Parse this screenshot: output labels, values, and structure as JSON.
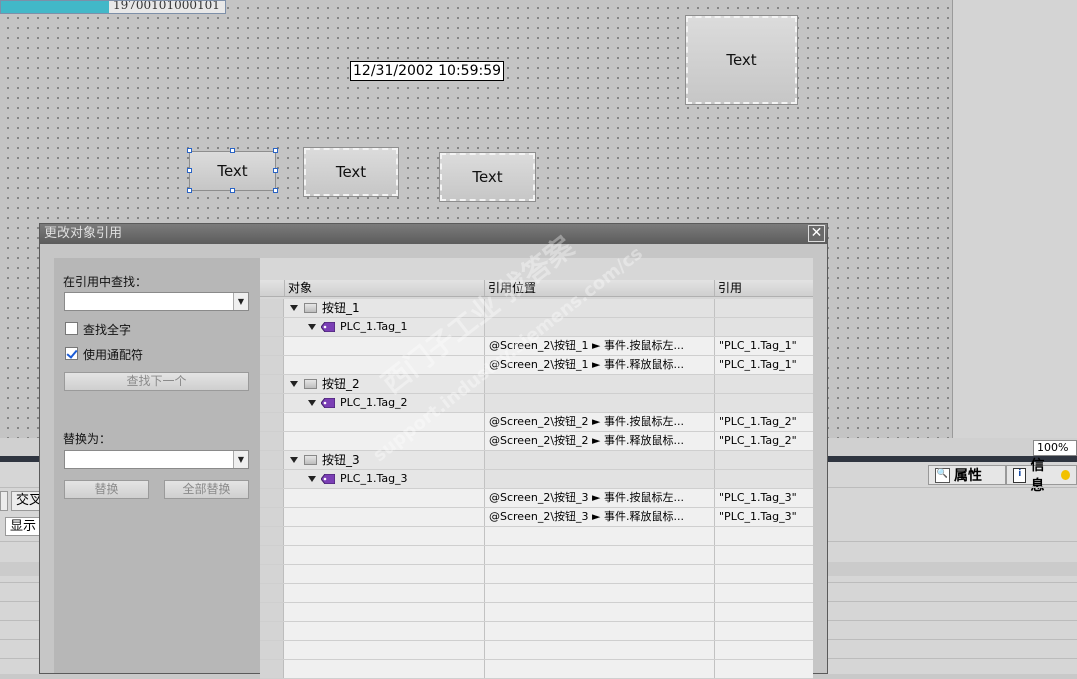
{
  "canvas": {
    "io_field_value": "19700101000101",
    "datetime": "12/31/2002 10:59:59",
    "buttons": {
      "b1": "Text",
      "b2": "Text",
      "b3": "Text",
      "b4": "Text"
    }
  },
  "zoom": "100%",
  "lower_panel": {
    "tab_properties": "属性",
    "tab_info": "信息",
    "tab_cross": "交叉",
    "show_label": "显示"
  },
  "dialog": {
    "title": "更改对象引用",
    "close": "✕",
    "search_label": "在引用中查找：",
    "search_value": "",
    "match_whole_word": "查找全字",
    "use_wildcards": "使用通配符",
    "find_next": "查找下一个",
    "replace_label": "替换为：",
    "replace_value": "",
    "replace": "替换",
    "replace_all": "全部替换",
    "columns": {
      "object": "对象",
      "location": "引用位置",
      "reference": "引用"
    },
    "rows": [
      {
        "type": "object",
        "name": "按钮_1"
      },
      {
        "type": "tag",
        "name": "PLC_1.Tag_1"
      },
      {
        "type": "ref",
        "location": "@Screen_2\\按钮_1 ► 事件.按鼠标左...",
        "reference": "\"PLC_1.Tag_1\""
      },
      {
        "type": "ref",
        "location": "@Screen_2\\按钮_1 ► 事件.释放鼠标...",
        "reference": "\"PLC_1.Tag_1\""
      },
      {
        "type": "object",
        "name": "按钮_2"
      },
      {
        "type": "tag",
        "name": "PLC_1.Tag_2"
      },
      {
        "type": "ref",
        "location": "@Screen_2\\按钮_2 ► 事件.按鼠标左...",
        "reference": "\"PLC_1.Tag_2\""
      },
      {
        "type": "ref",
        "location": "@Screen_2\\按钮_2 ► 事件.释放鼠标...",
        "reference": "\"PLC_1.Tag_2\""
      },
      {
        "type": "object",
        "name": "按钮_3"
      },
      {
        "type": "tag",
        "name": "PLC_1.Tag_3"
      },
      {
        "type": "ref",
        "location": "@Screen_2\\按钮_3 ► 事件.按鼠标左...",
        "reference": "\"PLC_1.Tag_3\""
      },
      {
        "type": "ref",
        "location": "@Screen_2\\按钮_3 ► 事件.释放鼠标...",
        "reference": "\"PLC_1.Tag_3\""
      }
    ]
  },
  "watermark": {
    "line1": "西门子工业 找答案",
    "line2": "support.industry.siemens.com/cs"
  }
}
